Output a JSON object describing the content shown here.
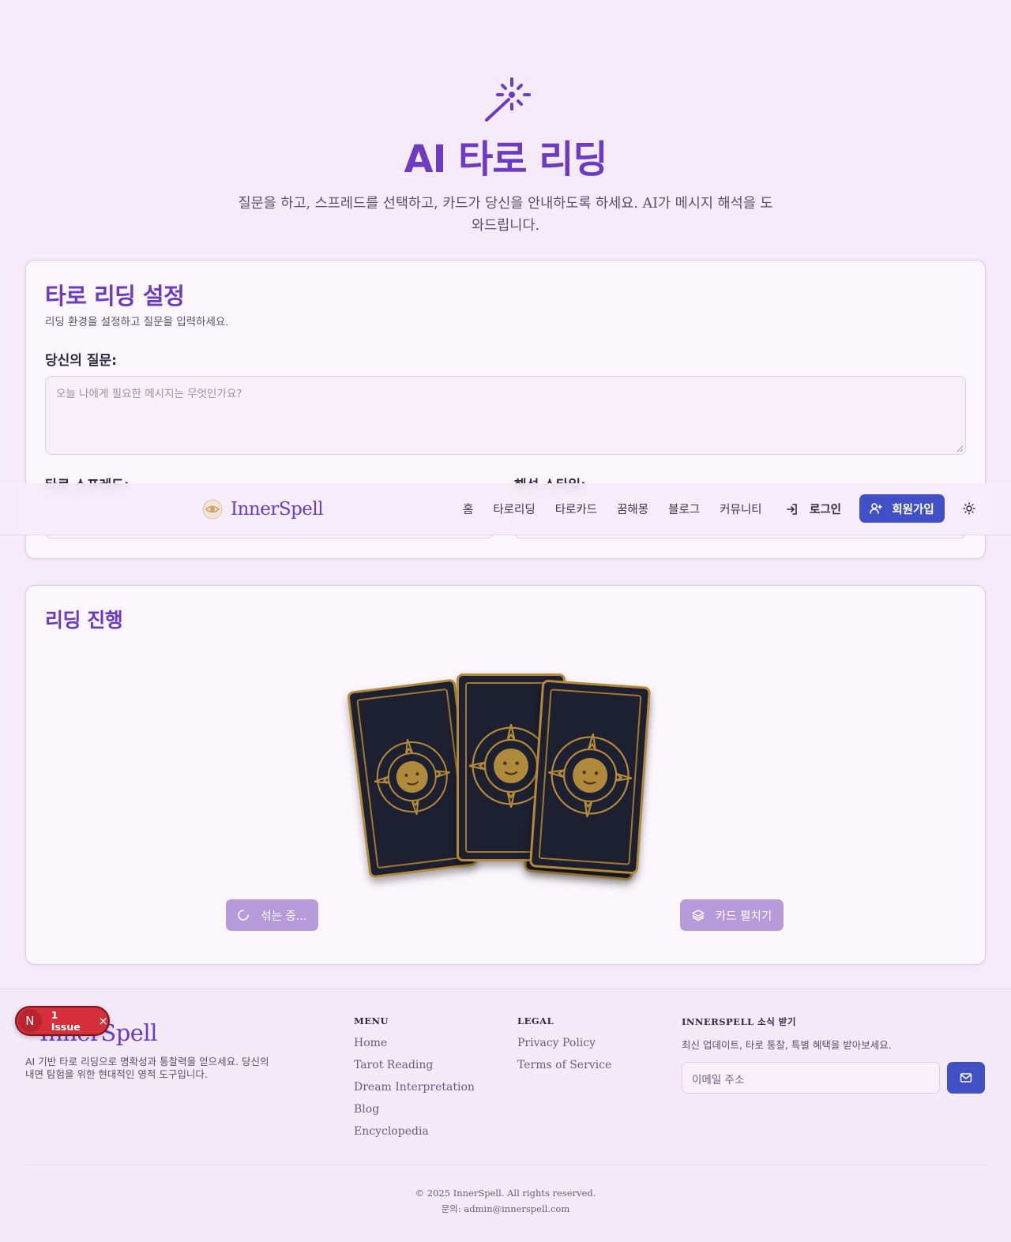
{
  "hero": {
    "title": "AI 타로 리딩",
    "subtitle": "질문을 하고, 스프레드를 선택하고, 카드가 당신을 안내하도록 하세요. AI가 메시지 해석을 도와드립니다."
  },
  "settings": {
    "title": "타로 리딩 설정",
    "description": "리딩 환경을 설정하고 질문을 입력하세요.",
    "question_label": "당신의 질문:",
    "question_placeholder": "오늘 나에게 필요한 메시지는 무엇인가요?",
    "spread_label": "타로 스프레드:",
    "style_label": "해석 스타일:"
  },
  "nav": {
    "brand": "InnerSpell",
    "links": [
      "홈",
      "타로리딩",
      "타로카드",
      "꿈해몽",
      "블로그",
      "커뮤니티"
    ],
    "login": "로그인",
    "signup": "회원가입",
    "theme_icon": "sun-icon"
  },
  "reading": {
    "title": "리딩 진행",
    "shuffle_button": "섞는 중...",
    "spread_button": "카드 펼치기"
  },
  "footer": {
    "brand": "InnerSpell",
    "description": "AI 기반 타로 리딩으로 명확성과 통찰력을 얻으세요. 당신의 내면 탐험을 위한 현대적인 영적 도구입니다.",
    "menu_title": "MENU",
    "menu_links": [
      "Home",
      "Tarot Reading",
      "Dream Interpretation",
      "Blog",
      "Encyclopedia"
    ],
    "legal_title": "LEGAL",
    "legal_links": [
      "Privacy Policy",
      "Terms of Service"
    ],
    "newsletter_title": "INNERSPELL 소식 받기",
    "newsletter_desc": "최신 업데이트, 타로 통찰, 특별 혜택을 받아보세요.",
    "email_placeholder": "이메일 주소",
    "copyright": "© 2025 InnerSpell. All rights reserved.",
    "contact": "문의: admin@innerspell.com"
  },
  "issue_badge": {
    "initial": "N",
    "label": "1 Issue",
    "close": "×"
  },
  "colors": {
    "accent": "#6c3bc2",
    "primary_button": "#4150c4",
    "background": "#f5eaf8",
    "disabled_button": "#b79ad9",
    "issue_red": "#d42f3a"
  }
}
